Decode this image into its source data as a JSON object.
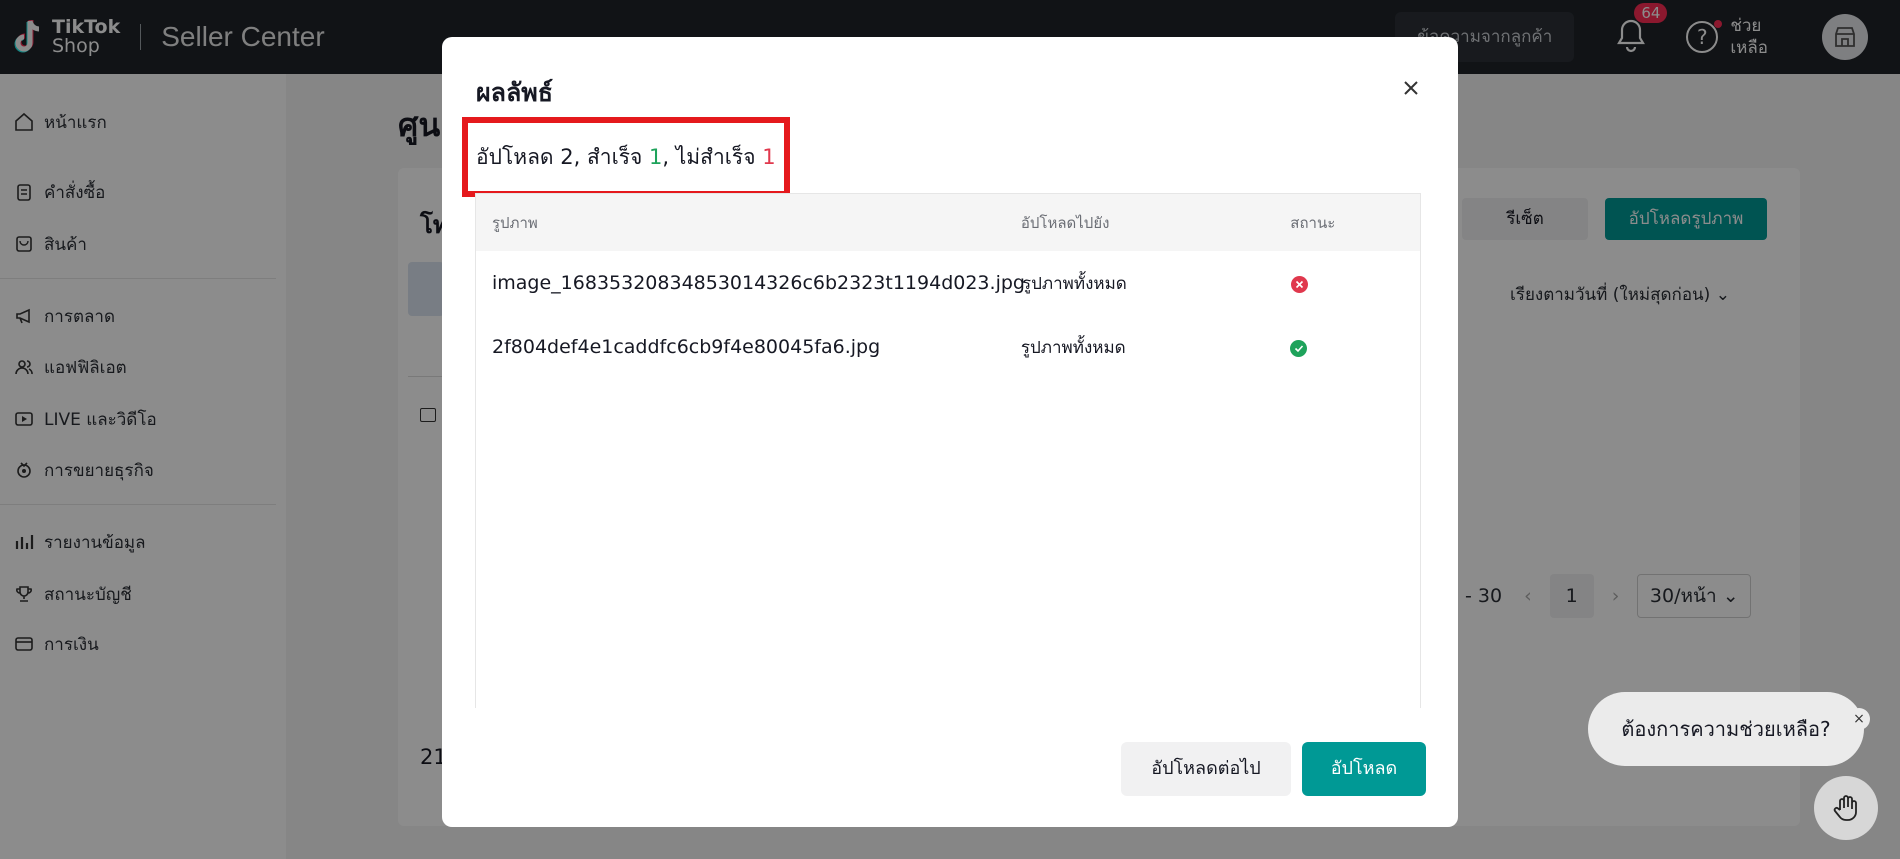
{
  "topbar": {
    "logo_tiktok": "TikTok",
    "logo_shop": "Shop",
    "title": "Seller Center",
    "customer_messages": "ข้อความจากลูกค้า",
    "notifications_count": "64",
    "help_label_line1": "ช่วย",
    "help_label_line2": "เหลือ"
  },
  "sidebar": {
    "items": [
      {
        "label": "หน้าแรก",
        "icon": "home-icon"
      },
      {
        "label": "คำสั่งซื้อ",
        "icon": "clipboard-icon"
      },
      {
        "label": "สินค้า",
        "icon": "product-icon"
      },
      {
        "label": "การตลาด",
        "icon": "megaphone-icon"
      },
      {
        "label": "แอฟฟิลิเอต",
        "icon": "users-icon"
      },
      {
        "label": "LIVE และวิดีโอ",
        "icon": "live-icon"
      },
      {
        "label": "การขยายธุรกิจ",
        "icon": "growth-icon"
      },
      {
        "label": "รายงานข้อมูล",
        "icon": "chart-icon"
      },
      {
        "label": "สถานะบัญชี",
        "icon": "trophy-icon"
      },
      {
        "label": "การเงิน",
        "icon": "wallet-icon"
      }
    ]
  },
  "background": {
    "page_title": "ศูน",
    "card_label": "โท",
    "reset_button": "รีเซ็ต",
    "upload_images_button": "อัปโหลดรูปภาพ",
    "sort_label": "เรียงตามวันที่ (ใหม่สุดก่อน)",
    "pager_range": "- 30",
    "pager_current": "1",
    "pager_size": "30/หน้า",
    "footer_count": "21"
  },
  "modal": {
    "title": "ผลลัพธ์",
    "summary_prefix": "อัปโหลด 2, สำเร็จ ",
    "summary_success": "1",
    "summary_middle": ", ไม่สำเร็จ ",
    "summary_fail": "1",
    "columns": [
      "รูปภาพ",
      "อัปโหลดไปยัง",
      "สถานะ"
    ],
    "rows": [
      {
        "file": "image_16835320834853014326c6b2323t1194d023.jpg",
        "destination": "รูปภาพทั้งหมด",
        "status": "failed"
      },
      {
        "file": "2f804def4e1caddfc6cb9f4e80045fa6.jpg",
        "destination": "รูปภาพทั้งหมด",
        "status": "success"
      }
    ],
    "continue_button": "อัปโหลดต่อไป",
    "upload_button": "อัปโหลด"
  },
  "help_widget": {
    "bubble_text": "ต้องการความช่วยเหลือ?",
    "close": "×"
  },
  "colors": {
    "accent": "#009995",
    "success": "#1ea35b",
    "error": "#e0384d",
    "highlight_box": "#e5191d",
    "topbar": "#1f2329"
  }
}
